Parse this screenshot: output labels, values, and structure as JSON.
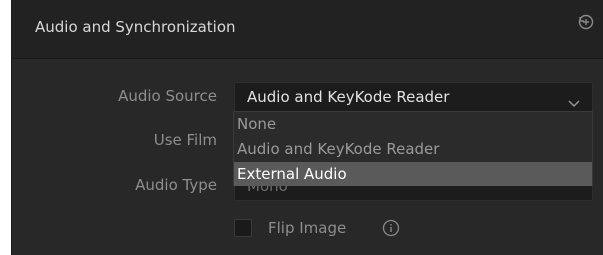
{
  "panel": {
    "title": "Audio and Synchronization",
    "reset_icon": "reset-icon"
  },
  "fields": {
    "audio_source_label": "Audio Source",
    "audio_source_value": "Audio and KeyKode Reader",
    "use_film_label": "Use Film",
    "audio_type_label": "Audio Type",
    "audio_type_value": "Mono"
  },
  "dropdown": {
    "items": [
      "None",
      "Audio and KeyKode Reader",
      "External Audio"
    ],
    "selected_item": "External Audio"
  },
  "flip_image": {
    "label": "Flip Image",
    "checked": false,
    "info_icon": "info-icon"
  },
  "colors": {
    "panel_bg": "#282828",
    "header_bg": "#222222",
    "input_bg": "#1c1c1c",
    "highlight": "#5a5a5a"
  }
}
